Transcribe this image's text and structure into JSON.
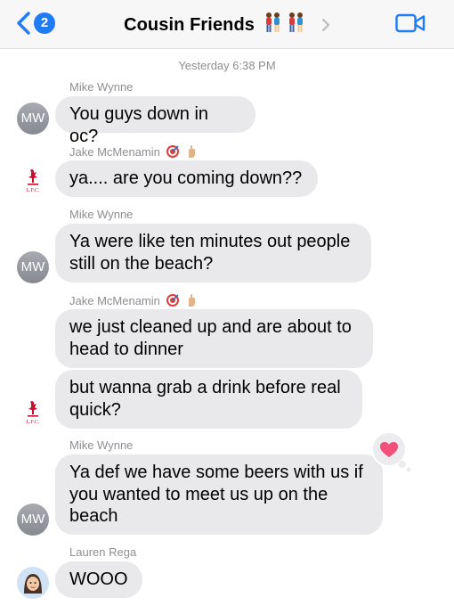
{
  "header": {
    "back_badge": "2",
    "title": "Cousin Friends",
    "title_emoji": "couple-emoji",
    "video_icon": "video-camera-icon"
  },
  "colors": {
    "accent": "#1f7cf5",
    "bubble": "#e9e9eb",
    "meta_text": "#8e8e93",
    "heart": "#f0507a"
  },
  "chat": {
    "timestamp": "Yesterday 6:38 PM",
    "messages": [
      {
        "sender": "Mike Wynne",
        "lines": [
          "You guys down in oc?"
        ],
        "avatar": "MW"
      },
      {
        "sender": "Jake McMenamin",
        "sender_emoji": [
          "dart-icon",
          "crossed-fingers-icon"
        ],
        "lines": [
          "ya.... are you coming down??"
        ],
        "avatar": "liverpool-fc-crest"
      },
      {
        "sender": "Mike Wynne",
        "lines": [
          "Ya were like ten minutes out people",
          "still on the beach?"
        ],
        "avatar": "MW"
      },
      {
        "sender": "Jake McMenamin",
        "sender_emoji": [
          "dart-icon",
          "crossed-fingers-icon"
        ],
        "lines": [
          "we just cleaned up and are about to",
          "head to dinner"
        ]
      },
      {
        "lines": [
          "but wanna grab a drink before real",
          "quick?"
        ],
        "avatar": "liverpool-fc-crest"
      },
      {
        "sender": "Mike Wynne",
        "lines": [
          "Ya def we have some beers with us if",
          "you wanted to meet us up on the",
          "beach"
        ],
        "avatar": "MW",
        "reaction": "heart-icon"
      },
      {
        "sender": "Lauren Rega",
        "lines": [
          "WOOO"
        ],
        "avatar": "memoji-avatar"
      }
    ]
  }
}
